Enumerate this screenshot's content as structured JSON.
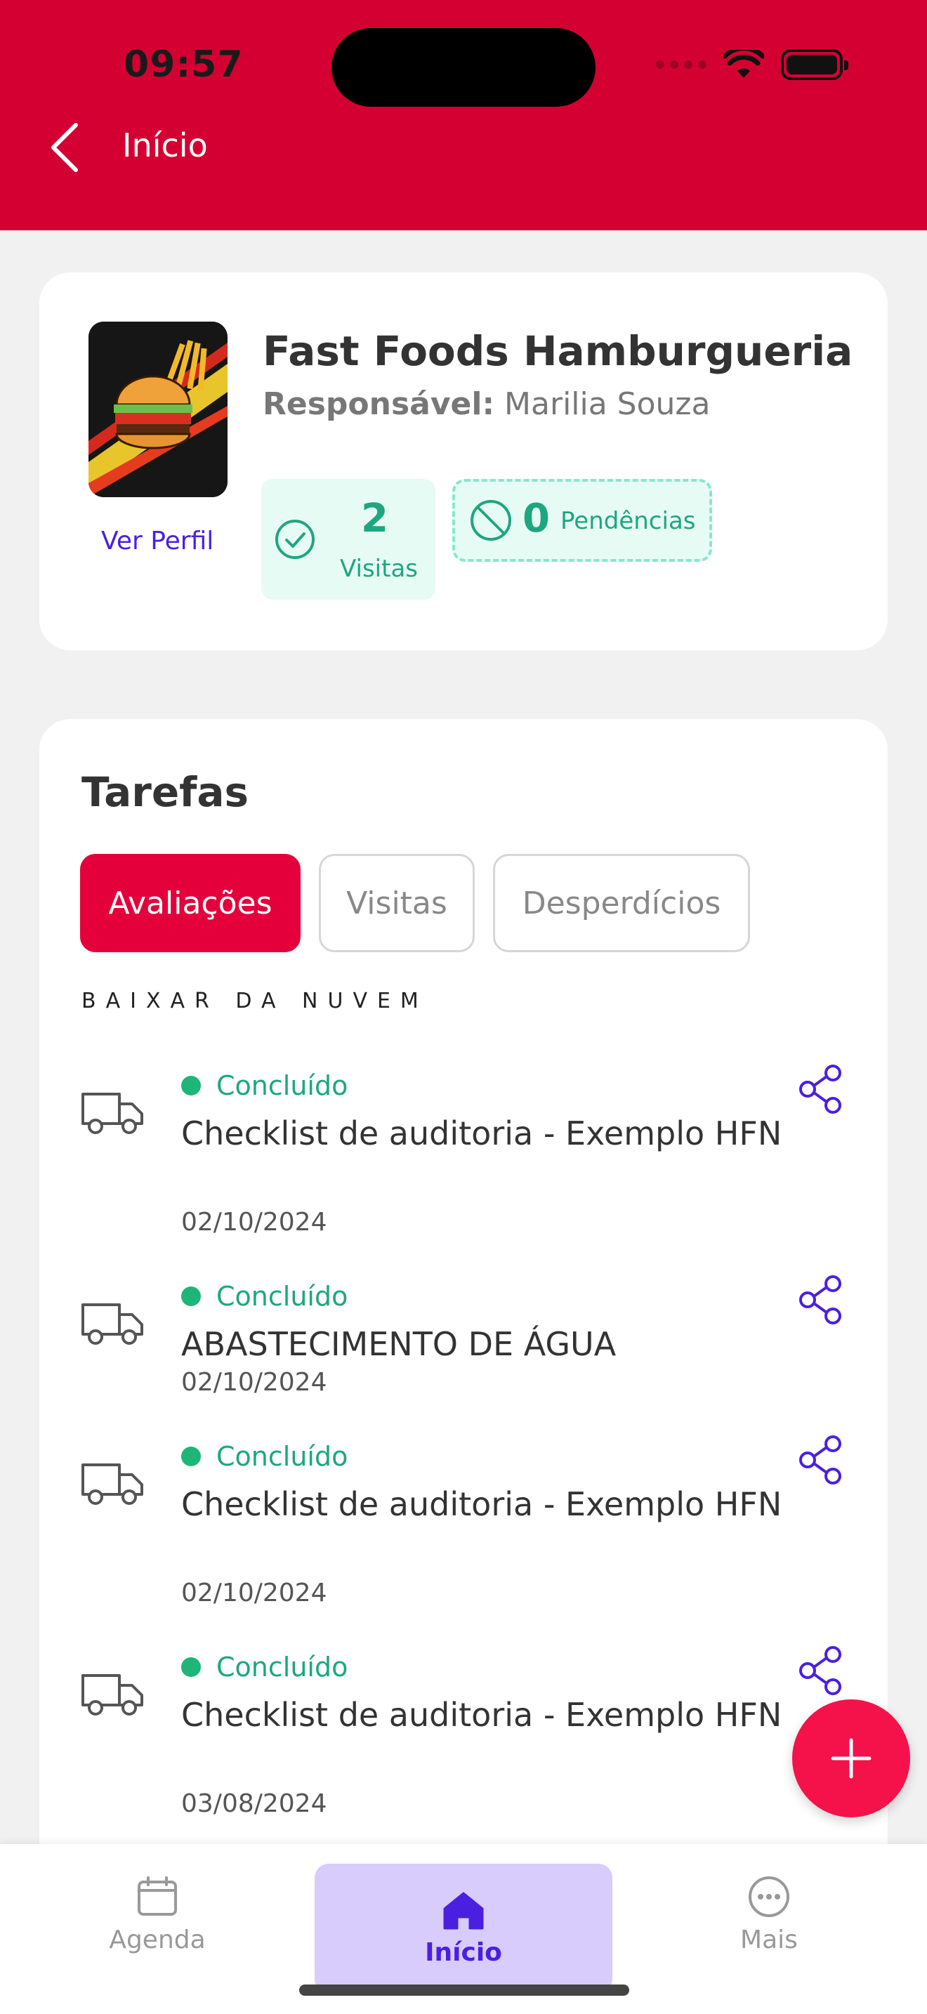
{
  "status_bar": {
    "time": "09:57"
  },
  "header": {
    "title": "Início"
  },
  "profile": {
    "company": "Fast Foods Hamburgueria",
    "responsible_label": "Responsável:",
    "responsible_name": "Marilia Souza",
    "view_profile": "Ver Perfil",
    "visits_count": "2",
    "visits_label": "Visitas",
    "pending_count": "0",
    "pending_label": "Pendências"
  },
  "tasks": {
    "title": "Tarefas",
    "tabs": [
      "Avaliações",
      "Visitas",
      "Desperdícios"
    ],
    "active_tab": "Avaliações",
    "cloud_label": "BAIXAR DA NUVEM",
    "items": [
      {
        "status": "Concluído",
        "name": "Checklist de auditoria - Exemplo HFN",
        "date": "02/10/2024"
      },
      {
        "status": "Concluído",
        "name": "ABASTECIMENTO DE ÁGUA",
        "date": "02/10/2024"
      },
      {
        "status": "Concluído",
        "name": "Checklist de auditoria - Exemplo HFN",
        "date": "02/10/2024"
      },
      {
        "status": "Concluído",
        "name": "Checklist de auditoria - Exemplo HFN",
        "date": "03/08/2024"
      }
    ]
  },
  "bottom_nav": {
    "items": [
      {
        "label": "Agenda",
        "icon": "calendar-icon"
      },
      {
        "label": "Início",
        "icon": "home-icon"
      },
      {
        "label": "Mais",
        "icon": "more-icon"
      }
    ],
    "active": "Início"
  },
  "colors": {
    "header": "#d50032",
    "accent": "#4b1fe0",
    "success": "#1da77e",
    "fab": "#f5114a"
  }
}
